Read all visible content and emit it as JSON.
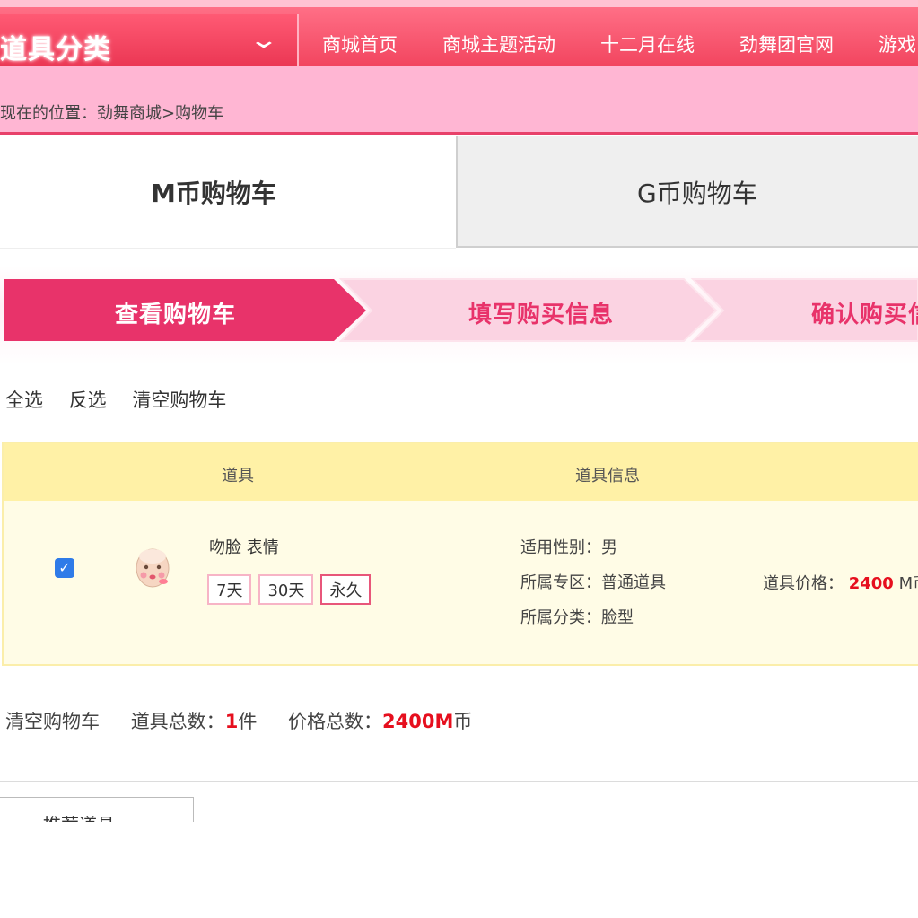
{
  "header": {
    "category_title": "道具分类",
    "nav": [
      "商城首页",
      "商城主题活动",
      "十二月在线",
      "劲舞团官网",
      "游戏"
    ]
  },
  "breadcrumb": {
    "label": "现在的位置：",
    "path": "劲舞商城>购物车"
  },
  "tabs": [
    {
      "label": "M币购物车",
      "active": true
    },
    {
      "label": "G币购物车",
      "active": false
    }
  ],
  "steps": [
    "查看购物车",
    "填写购买信息",
    "确认购买信息"
  ],
  "cart_actions": {
    "select_all": "全选",
    "invert": "反选",
    "clear": "清空购物车"
  },
  "table": {
    "headers": {
      "item": "道具",
      "info": "道具信息"
    },
    "rows": [
      {
        "checked": true,
        "name": "吻脸 表情",
        "durations": [
          "7天",
          "30天",
          "永久"
        ],
        "selected_duration": "永久",
        "gender_label": "适用性别：",
        "gender": "男",
        "zone_label": "所属专区：",
        "zone": "普通道具",
        "category_label": "所属分类：",
        "category": "脸型",
        "price_label": "道具价格：",
        "price": "2400",
        "currency": "M币"
      }
    ]
  },
  "summary": {
    "clear": "清空购物车",
    "count_label": "道具总数：",
    "count": "1",
    "count_unit": "件",
    "total_label": "价格总数：",
    "total": "2400M",
    "total_unit": "币"
  },
  "recommend": {
    "label": "推荐道具"
  },
  "colors": {
    "accent": "#e8336a",
    "price": "#e60f1e",
    "header": "#f2455f"
  }
}
